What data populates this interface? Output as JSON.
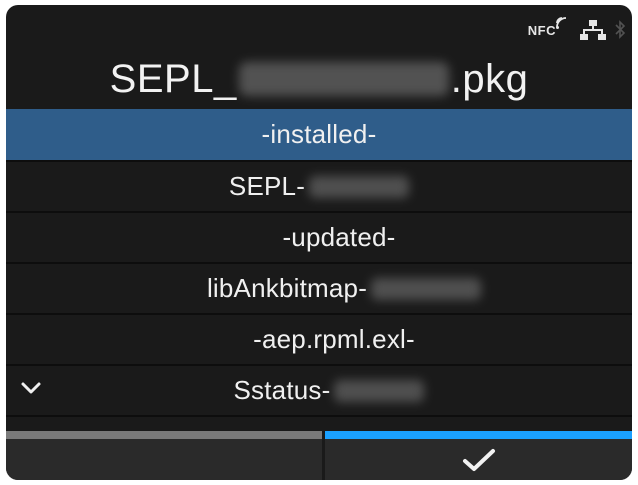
{
  "header": {
    "title_prefix": "SEPL_",
    "title_suffix": ".pkg"
  },
  "status_bar": {
    "nfc_label": "NFC",
    "icons": [
      "nfc-icon",
      "network-icon",
      "bluetooth-icon"
    ]
  },
  "list": {
    "items": [
      {
        "label": "-installed-",
        "selected": true
      },
      {
        "label": "SEPL-"
      },
      {
        "label": "-updated-"
      },
      {
        "label": "libAnkbitmap-"
      },
      {
        "label": "-aep.rpml.exl-"
      },
      {
        "label": "Sstatus-"
      }
    ],
    "scroll_icon": "chevron-down-icon"
  },
  "footer": {
    "left_button": "",
    "right_button_icon": "check-icon"
  },
  "colors": {
    "selected_row": "#2f5d8a",
    "accent": "#1aa0ff",
    "background": "#1a1a1a"
  }
}
